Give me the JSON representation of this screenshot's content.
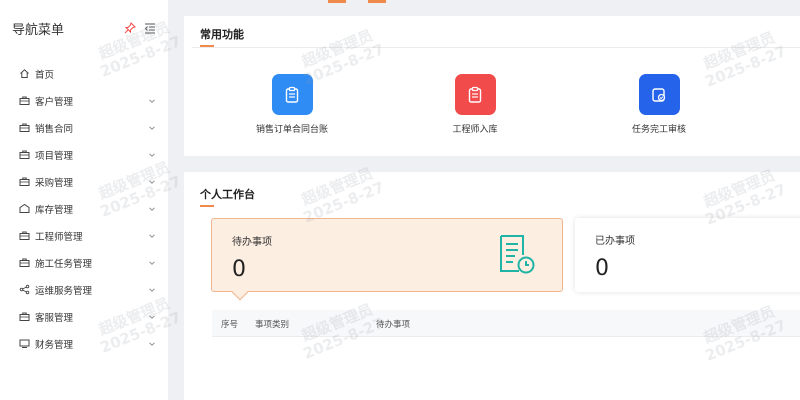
{
  "sidebar": {
    "title": "导航菜单",
    "items": [
      {
        "label": "首页",
        "icon": "home-icon",
        "has_children": false
      },
      {
        "label": "客户管理",
        "icon": "briefcase-icon",
        "has_children": true
      },
      {
        "label": "销售合同",
        "icon": "briefcase-icon",
        "has_children": true
      },
      {
        "label": "项目管理",
        "icon": "briefcase-icon",
        "has_children": true
      },
      {
        "label": "采购管理",
        "icon": "briefcase-icon",
        "has_children": true
      },
      {
        "label": "库存管理",
        "icon": "warehouse-icon",
        "has_children": true
      },
      {
        "label": "工程师管理",
        "icon": "briefcase-icon",
        "has_children": true
      },
      {
        "label": "施工任务管理",
        "icon": "briefcase-icon",
        "has_children": true
      },
      {
        "label": "运维服务管理",
        "icon": "share-icon",
        "has_children": true
      },
      {
        "label": "客服管理",
        "icon": "briefcase-icon",
        "has_children": true
      },
      {
        "label": "财务管理",
        "icon": "monitor-icon",
        "has_children": true
      }
    ]
  },
  "common_functions": {
    "title": "常用功能",
    "items": [
      {
        "label": "销售订单合同台账",
        "icon": "clipboard-icon",
        "color": "#2f8cf5"
      },
      {
        "label": "工程师入库",
        "icon": "clipboard-icon",
        "color": "#f24b4b"
      },
      {
        "label": "任务完工审核",
        "icon": "audit-icon",
        "color": "#2563eb"
      }
    ]
  },
  "workbench": {
    "title": "个人工作台",
    "todo": {
      "label": "待办事项",
      "value": "0"
    },
    "done": {
      "label": "已办事项",
      "value": "0"
    },
    "table_headers": [
      "序号",
      "事项类别",
      "待办事项"
    ]
  },
  "watermark": {
    "name": "超级管理员",
    "date": "2025-8-27"
  },
  "colors": {
    "accent": "#f08a4b",
    "todo_bg": "#fdeee2",
    "teal_icon": "#1fb4a6"
  }
}
